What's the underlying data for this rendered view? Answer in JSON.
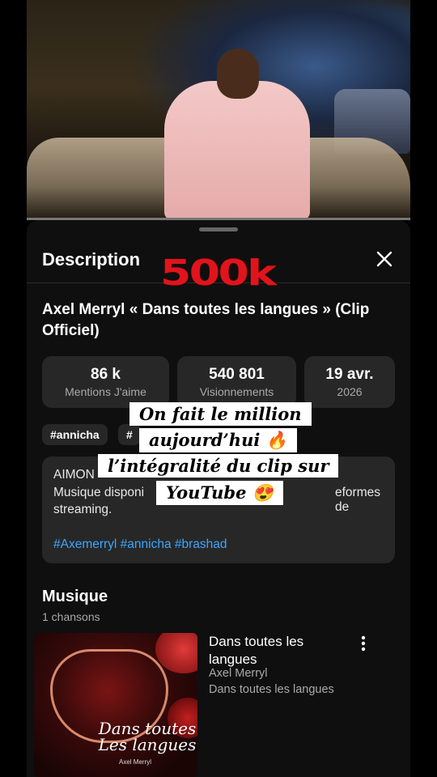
{
  "overlay": {
    "badge": "500k",
    "lines": [
      "On fait le million",
      "aujourd’hui 🔥",
      "l’intégralité du clip sur",
      "YouTube 😍"
    ]
  },
  "sheet": {
    "title": "Description",
    "video_title": "Axel Merryl « Dans toutes les langues » (Clip Officiel)"
  },
  "stats": [
    {
      "value": "86 k",
      "label": "Mentions J'aime"
    },
    {
      "value": "540 801",
      "label": "Visionnements"
    },
    {
      "value": "19 avr.",
      "label": "2026"
    }
  ],
  "hashtags": [
    "#annicha",
    "#"
  ],
  "description": {
    "line1": "AIMON",
    "line2": "Musique disponi",
    "line2_end": "eformes de",
    "line3": "streaming.",
    "tags": "#Axemerryl #annicha #brashad"
  },
  "music": {
    "title": "Musique",
    "count": "1 chansons",
    "song": {
      "title": "Dans toutes les langues",
      "artist": "Axel Merryl",
      "album": "Dans toutes les langues",
      "cover_title": "Dans toutes Les langues",
      "cover_artist": "Axel Merryl"
    }
  }
}
